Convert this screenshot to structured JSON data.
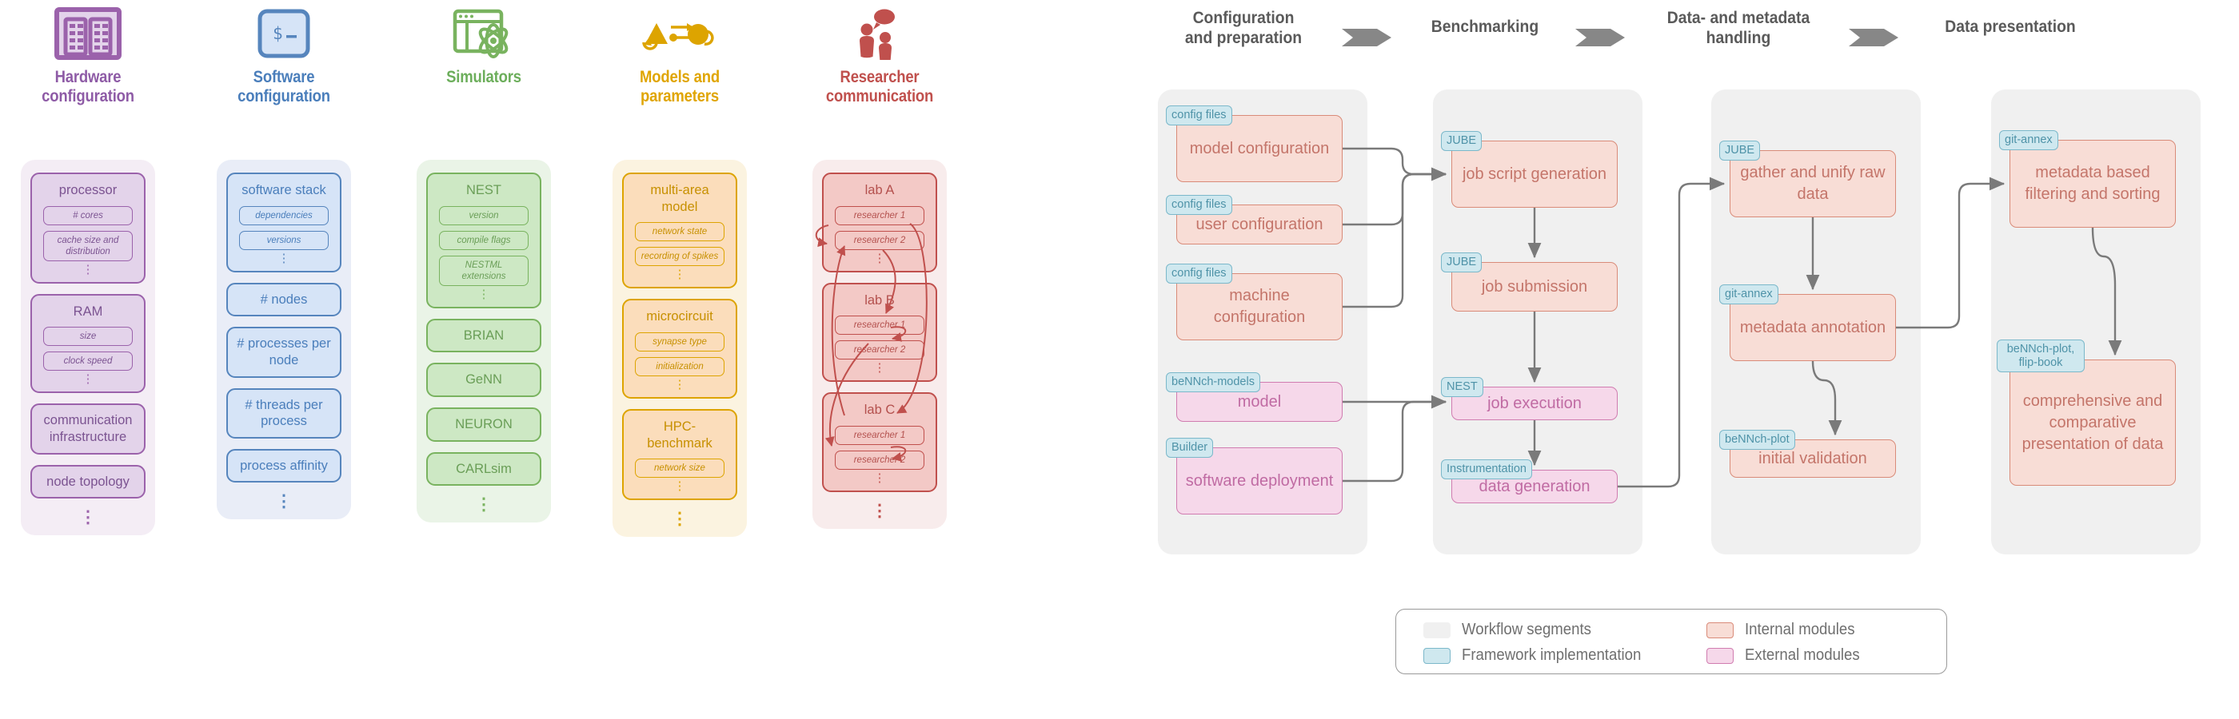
{
  "left_panel": {
    "columns": [
      {
        "key": "hardware",
        "icon": "server-racks-icon",
        "title": "Hardware\nconfiguration",
        "title_l1": "Hardware",
        "title_l2": "configuration",
        "accent": "#8e5ba6",
        "groups": [
          {
            "label": "processor",
            "leaves": [
              "# cores",
              "cache size and distribution"
            ],
            "has_dots": true
          },
          {
            "label": "RAM",
            "leaves": [
              "size",
              "clock speed"
            ],
            "has_dots": true
          },
          {
            "label": "communication infrastructure",
            "leaves": [],
            "flat": true
          },
          {
            "label": "node topology",
            "leaves": [],
            "flat": true
          }
        ],
        "trailing_dots": true
      },
      {
        "key": "software",
        "icon": "terminal-prompt-icon",
        "title_l1": "Software",
        "title_l2": "configuration",
        "accent": "#4a7ebb",
        "groups": [
          {
            "label": "software stack",
            "leaves": [
              "dependencies",
              "versions"
            ],
            "has_dots": true
          },
          {
            "label": "# nodes",
            "leaves": [],
            "flat": true
          },
          {
            "label": "# processes per node",
            "leaves": [],
            "flat": true
          },
          {
            "label": "# threads per process",
            "leaves": [],
            "flat": true
          },
          {
            "label": "process affinity",
            "leaves": [],
            "flat": true
          }
        ],
        "trailing_dots": true
      },
      {
        "key": "simulators",
        "icon": "browser-atom-icon",
        "title_l1": "Simulators",
        "title_l2": "",
        "accent": "#6cae5b",
        "groups": [
          {
            "label": "NEST",
            "leaves": [
              "version",
              "compile flags",
              "NESTML extensions"
            ],
            "has_dots": true
          },
          {
            "label": "BRIAN",
            "leaves": [],
            "flat": true
          },
          {
            "label": "GeNN",
            "leaves": [],
            "flat": true
          },
          {
            "label": "NEURON",
            "leaves": [],
            "flat": true
          },
          {
            "label": "CARLsim",
            "leaves": [],
            "flat": true
          }
        ],
        "trailing_dots": true
      },
      {
        "key": "models",
        "icon": "network-nodes-icon",
        "title_l1": "Models and",
        "title_l2": "parameters",
        "accent": "#e0a500",
        "groups": [
          {
            "label": "multi-area model",
            "leaves": [
              "network state",
              "recording of spikes"
            ],
            "has_dots": true
          },
          {
            "label": "microcircuit",
            "leaves": [
              "synapse type",
              "initialization"
            ],
            "has_dots": true
          },
          {
            "label": "HPC-benchmark",
            "leaves": [
              "network size"
            ],
            "has_dots": true
          }
        ],
        "trailing_dots": true
      },
      {
        "key": "researchers",
        "icon": "people-speech-icon",
        "title_l1": "Researcher",
        "title_l2": "communication",
        "accent": "#c0504d",
        "groups": [
          {
            "label": "lab A",
            "leaves": [
              "researcher 1",
              "researcher 2"
            ],
            "has_dots": true
          },
          {
            "label": "lab B",
            "leaves": [
              "researcher 1",
              "researcher 2"
            ],
            "has_dots": true
          },
          {
            "label": "lab C",
            "leaves": [
              "researcher 1",
              "researcher 2"
            ],
            "has_dots": true
          }
        ],
        "trailing_dots": true
      }
    ]
  },
  "right_panel": {
    "phases": [
      {
        "line1": "Configuration",
        "line2": "and preparation"
      },
      {
        "line1": "Benchmarking",
        "line2": ""
      },
      {
        "line1": "Data- and metadata",
        "line2": "handling"
      },
      {
        "line1": "Data presentation",
        "line2": ""
      }
    ],
    "segments": [
      {
        "key": "configuration",
        "modules": [
          {
            "tag": "config files",
            "label": "model configuration",
            "kind": "internal"
          },
          {
            "tag": "config files",
            "label": "user configuration",
            "kind": "internal"
          },
          {
            "tag": "config files",
            "label": "machine configuration",
            "kind": "internal"
          },
          {
            "tag": "beNNch-models",
            "label": "model",
            "kind": "external"
          },
          {
            "tag": "Builder",
            "label": "software deployment",
            "kind": "external"
          }
        ]
      },
      {
        "key": "benchmarking",
        "modules": [
          {
            "tag": "JUBE",
            "label": "job script generation",
            "kind": "internal"
          },
          {
            "tag": "JUBE",
            "label": "job submission",
            "kind": "internal"
          },
          {
            "tag": "NEST",
            "label": "job execution",
            "kind": "external"
          },
          {
            "tag": "Instrumentation",
            "label": "data generation",
            "kind": "external"
          }
        ]
      },
      {
        "key": "data_handling",
        "modules": [
          {
            "tag": "JUBE",
            "label": "gather and unify raw data",
            "kind": "internal"
          },
          {
            "tag": "git-annex",
            "label": "metadata annotation",
            "kind": "internal"
          },
          {
            "tag": "beNNch-plot",
            "label": "initial validation",
            "kind": "internal"
          }
        ]
      },
      {
        "key": "data_presentation",
        "modules": [
          {
            "tag": "git-annex",
            "label": "metadata based filtering and sorting",
            "kind": "internal"
          },
          {
            "tag": "beNNch-plot, flip-book",
            "label": "comprehensive and comparative presentation of data",
            "kind": "internal"
          }
        ]
      }
    ],
    "legend": {
      "items": [
        {
          "label": "Workflow segments",
          "fill": "#f0f0f0",
          "border": "#f0f0f0"
        },
        {
          "label": "Framework implementation",
          "fill": "#cfe8ef",
          "border": "#7bb8ca"
        },
        {
          "label": "Internal modules",
          "fill": "#f8ddd6",
          "border": "#d98b79"
        },
        {
          "label": "External modules",
          "fill": "#f6d8ea",
          "border": "#d07cb0"
        }
      ]
    }
  }
}
